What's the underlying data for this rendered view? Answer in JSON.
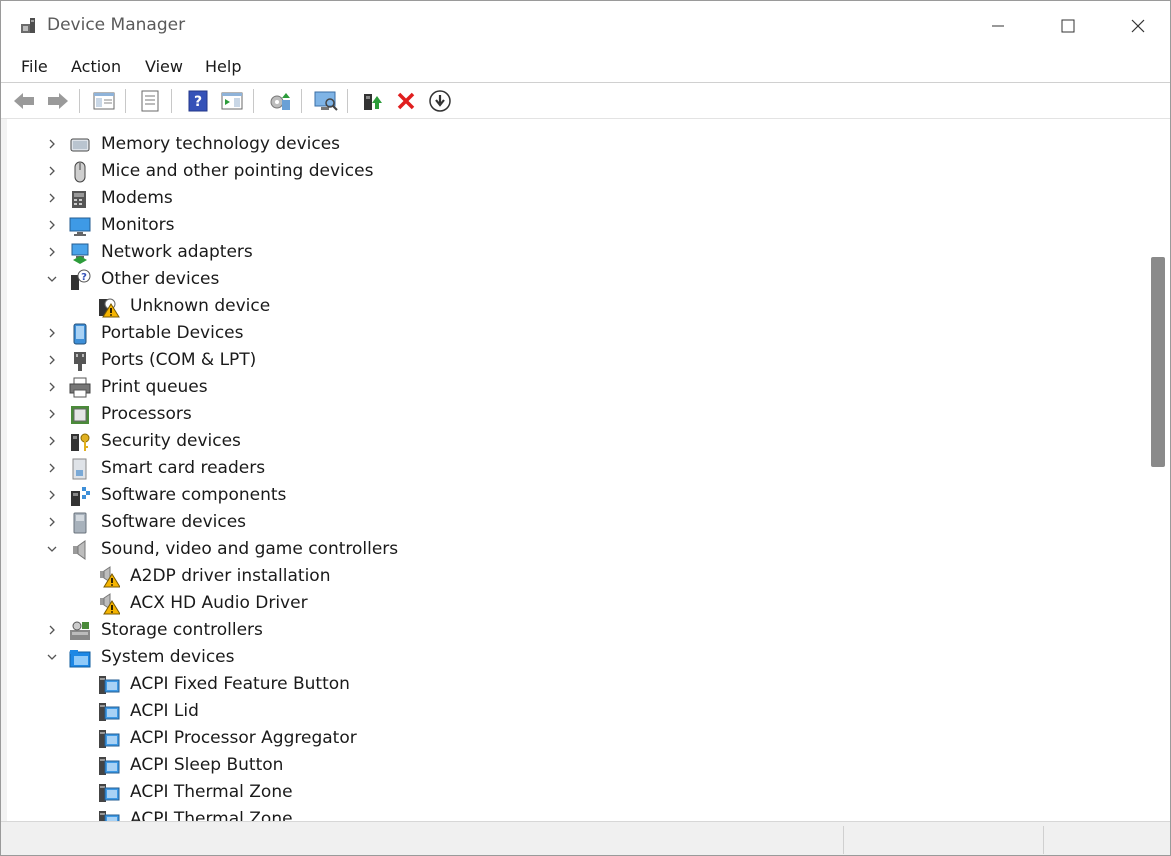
{
  "window": {
    "title": "Device Manager"
  },
  "menu": {
    "items": [
      "File",
      "Action",
      "View",
      "Help"
    ]
  },
  "toolbar": {
    "buttons": [
      "back-icon",
      "forward-icon",
      "show-hide-console-tree-icon",
      "properties-icon",
      "help-icon",
      "show-action-pane-icon",
      "update-driver-icon",
      "scan-hardware-icon",
      "enable-device-icon",
      "uninstall-device-icon",
      "download-icon"
    ]
  },
  "tree": {
    "rows": [
      {
        "label": "Memory technology devices",
        "level": 0,
        "expanded": false,
        "icon": "memory-icon"
      },
      {
        "label": "Mice and other pointing devices",
        "level": 0,
        "expanded": false,
        "icon": "mouse-icon"
      },
      {
        "label": "Modems",
        "level": 0,
        "expanded": false,
        "icon": "modem-icon"
      },
      {
        "label": "Monitors",
        "level": 0,
        "expanded": false,
        "icon": "monitor-icon"
      },
      {
        "label": "Network adapters",
        "level": 0,
        "expanded": false,
        "icon": "network-icon"
      },
      {
        "label": "Other devices",
        "level": 0,
        "expanded": true,
        "icon": "unknown-device-icon"
      },
      {
        "label": "Unknown device",
        "level": 1,
        "icon": "warning-device-icon"
      },
      {
        "label": "Portable Devices",
        "level": 0,
        "expanded": false,
        "icon": "portable-icon"
      },
      {
        "label": "Ports (COM & LPT)",
        "level": 0,
        "expanded": false,
        "icon": "port-icon"
      },
      {
        "label": "Print queues",
        "level": 0,
        "expanded": false,
        "icon": "printer-icon"
      },
      {
        "label": "Processors",
        "level": 0,
        "expanded": false,
        "icon": "processor-icon"
      },
      {
        "label": "Security devices",
        "level": 0,
        "expanded": false,
        "icon": "security-icon"
      },
      {
        "label": "Smart card readers",
        "level": 0,
        "expanded": false,
        "icon": "smartcard-icon"
      },
      {
        "label": "Software components",
        "level": 0,
        "expanded": false,
        "icon": "software-component-icon"
      },
      {
        "label": "Software devices",
        "level": 0,
        "expanded": false,
        "icon": "software-device-icon"
      },
      {
        "label": "Sound, video and game controllers",
        "level": 0,
        "expanded": true,
        "icon": "speaker-icon"
      },
      {
        "label": "A2DP driver installation",
        "level": 1,
        "icon": "warning-speaker-icon"
      },
      {
        "label": "ACX HD Audio Driver",
        "level": 1,
        "icon": "warning-speaker-icon"
      },
      {
        "label": "Storage controllers",
        "level": 0,
        "expanded": false,
        "icon": "storage-icon"
      },
      {
        "label": "System devices",
        "level": 0,
        "expanded": true,
        "icon": "system-folder-icon"
      },
      {
        "label": "ACPI Fixed Feature Button",
        "level": 1,
        "icon": "system-device-icon"
      },
      {
        "label": "ACPI Lid",
        "level": 1,
        "icon": "system-device-icon"
      },
      {
        "label": "ACPI Processor Aggregator",
        "level": 1,
        "icon": "system-device-icon"
      },
      {
        "label": "ACPI Sleep Button",
        "level": 1,
        "icon": "system-device-icon"
      },
      {
        "label": "ACPI Thermal Zone",
        "level": 1,
        "icon": "system-device-icon"
      },
      {
        "label": "ACPI Thermal Zone",
        "level": 1,
        "icon": "system-device-icon"
      }
    ]
  },
  "colors": {
    "accent": "#1e88e5",
    "warning": "#f5b400",
    "error": "#e01e1e",
    "scroll_thumb": "#8a8a8a"
  }
}
